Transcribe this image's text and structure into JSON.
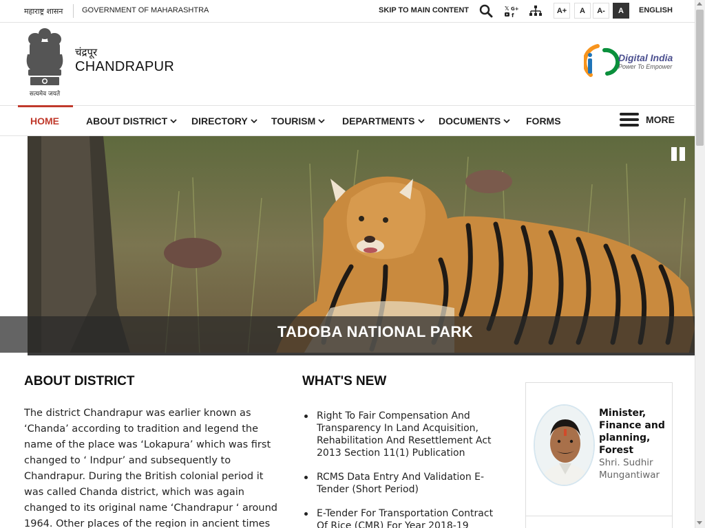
{
  "topbar": {
    "gov_hindi": "महाराष्ट्र शासन",
    "gov_english": "GOVERNMENT OF MAHARASHTRA",
    "skip_link": "SKIP TO MAIN CONTENT",
    "font_buttons": [
      "A+",
      "A",
      "A-",
      "A"
    ],
    "language": "ENGLISH",
    "icons": [
      "search-icon",
      "social-media-icon",
      "sitemap-icon"
    ]
  },
  "header": {
    "emblem_motto": "सत्यमेव जयते",
    "site_title_hindi": "चंद्रपूर",
    "site_title_english": "CHANDRAPUR",
    "partner_logo_title": "Digital India",
    "partner_logo_tagline": "Power To Empower"
  },
  "nav": {
    "items": [
      {
        "label": "HOME",
        "active": true,
        "dropdown": false
      },
      {
        "label": "ABOUT DISTRICT",
        "dropdown": true
      },
      {
        "label": "DIRECTORY",
        "dropdown": true
      },
      {
        "label": "TOURISM",
        "dropdown": true
      },
      {
        "label": "DEPARTMENTS",
        "dropdown": true
      },
      {
        "label": "DOCUMENTS",
        "dropdown": true
      },
      {
        "label": "FORMS",
        "dropdown": false
      }
    ],
    "more_label": "MORE"
  },
  "banner": {
    "caption": "TADOBA NATIONAL PARK",
    "control": "pause-icon"
  },
  "about": {
    "heading": "ABOUT DISTRICT",
    "text": "The district Chandrapur was earlier known as ‘Chanda’ according to tradition and legend the name of the place was ‘Lokapura’ which was first changed to ‘ Indpur’ and subsequently to Chandrapur. During the British colonial period it was called Chanda district, which was again changed to its original name ‘Chandrapur ‘ around 1964. Other places of the region in ancient times include wairangad, Kosala, Bhadravati"
  },
  "whats_new": {
    "heading": "WHAT'S NEW",
    "items": [
      "Right To Fair Compensation And Transparency In Land Acquisition, Rehabilitation And Resettlement Act 2013 Section 11(1) Publication",
      "RCMS Data Entry And Validation E-Tender (Short Period)",
      "E-Tender For Transportation Contract Of Rice (CMR) For Year 2018-19"
    ]
  },
  "minister": {
    "role": "Minister, Finance and planning, Forest",
    "name": "Shri. Sudhir Mungantiwar"
  },
  "colors": {
    "accent": "#c0392b",
    "caption_bg": "#282828",
    "text": "#222222"
  }
}
